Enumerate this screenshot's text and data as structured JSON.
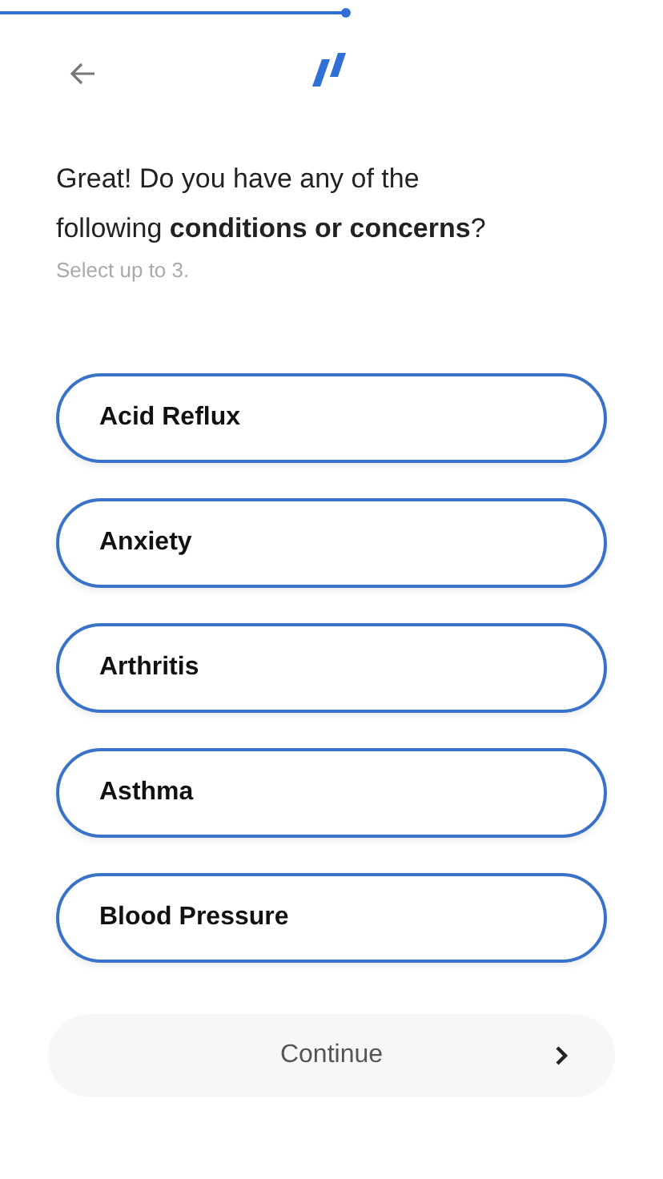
{
  "question": "Great! Do you have any of the following **conditions or concerns**?",
  "hint": "Select up to 3.",
  "options": [
    {
      "label": "Acid Reflux",
      "selected": false
    },
    {
      "label": "Anxiety",
      "selected": false
    },
    {
      "label": "Arthritis",
      "selected": false
    },
    {
      "label": "Asthma",
      "selected": false
    },
    {
      "label": "Blood Pressure",
      "selected": false
    }
  ],
  "continue_button": {
    "label": "Continue",
    "disabled": true
  }
}
